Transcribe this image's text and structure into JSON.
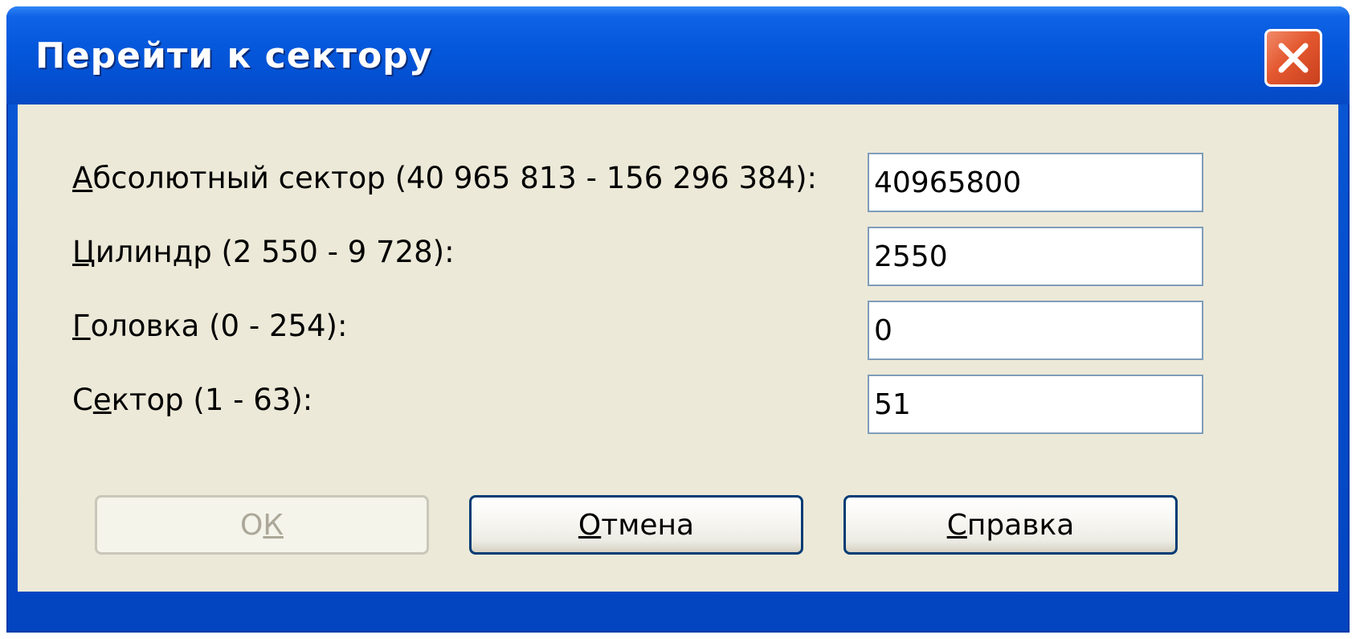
{
  "window": {
    "title": "Перейти к сектору",
    "close_icon": "close-icon"
  },
  "fields": [
    {
      "label_prefix": "",
      "label_access": "А",
      "label_rest": "бсолютный сектор (40 965 813 - 156 296 384):",
      "value": "40965800"
    },
    {
      "label_prefix": "",
      "label_access": "Ц",
      "label_rest": "илиндр (2 550 - 9 728):",
      "value": "2550"
    },
    {
      "label_prefix": "",
      "label_access": "Г",
      "label_rest": "оловка (0 - 254):",
      "value": "0"
    },
    {
      "label_prefix": "С",
      "label_access": "е",
      "label_rest": "ктор (1 - 63):",
      "value": "51"
    }
  ],
  "buttons": {
    "ok": {
      "prefix": "О",
      "access": "К",
      "rest": "",
      "enabled": false
    },
    "cancel": {
      "prefix": "",
      "access": "О",
      "rest": "тмена",
      "enabled": true
    },
    "help": {
      "prefix": "",
      "access": "С",
      "rest": "правка",
      "enabled": true
    }
  },
  "colors": {
    "titlebar": "#0558dc",
    "client_bg": "#ece9d8",
    "field_border": "#7f9db9",
    "button_border": "#003c74",
    "close_button": "#e4582f"
  }
}
